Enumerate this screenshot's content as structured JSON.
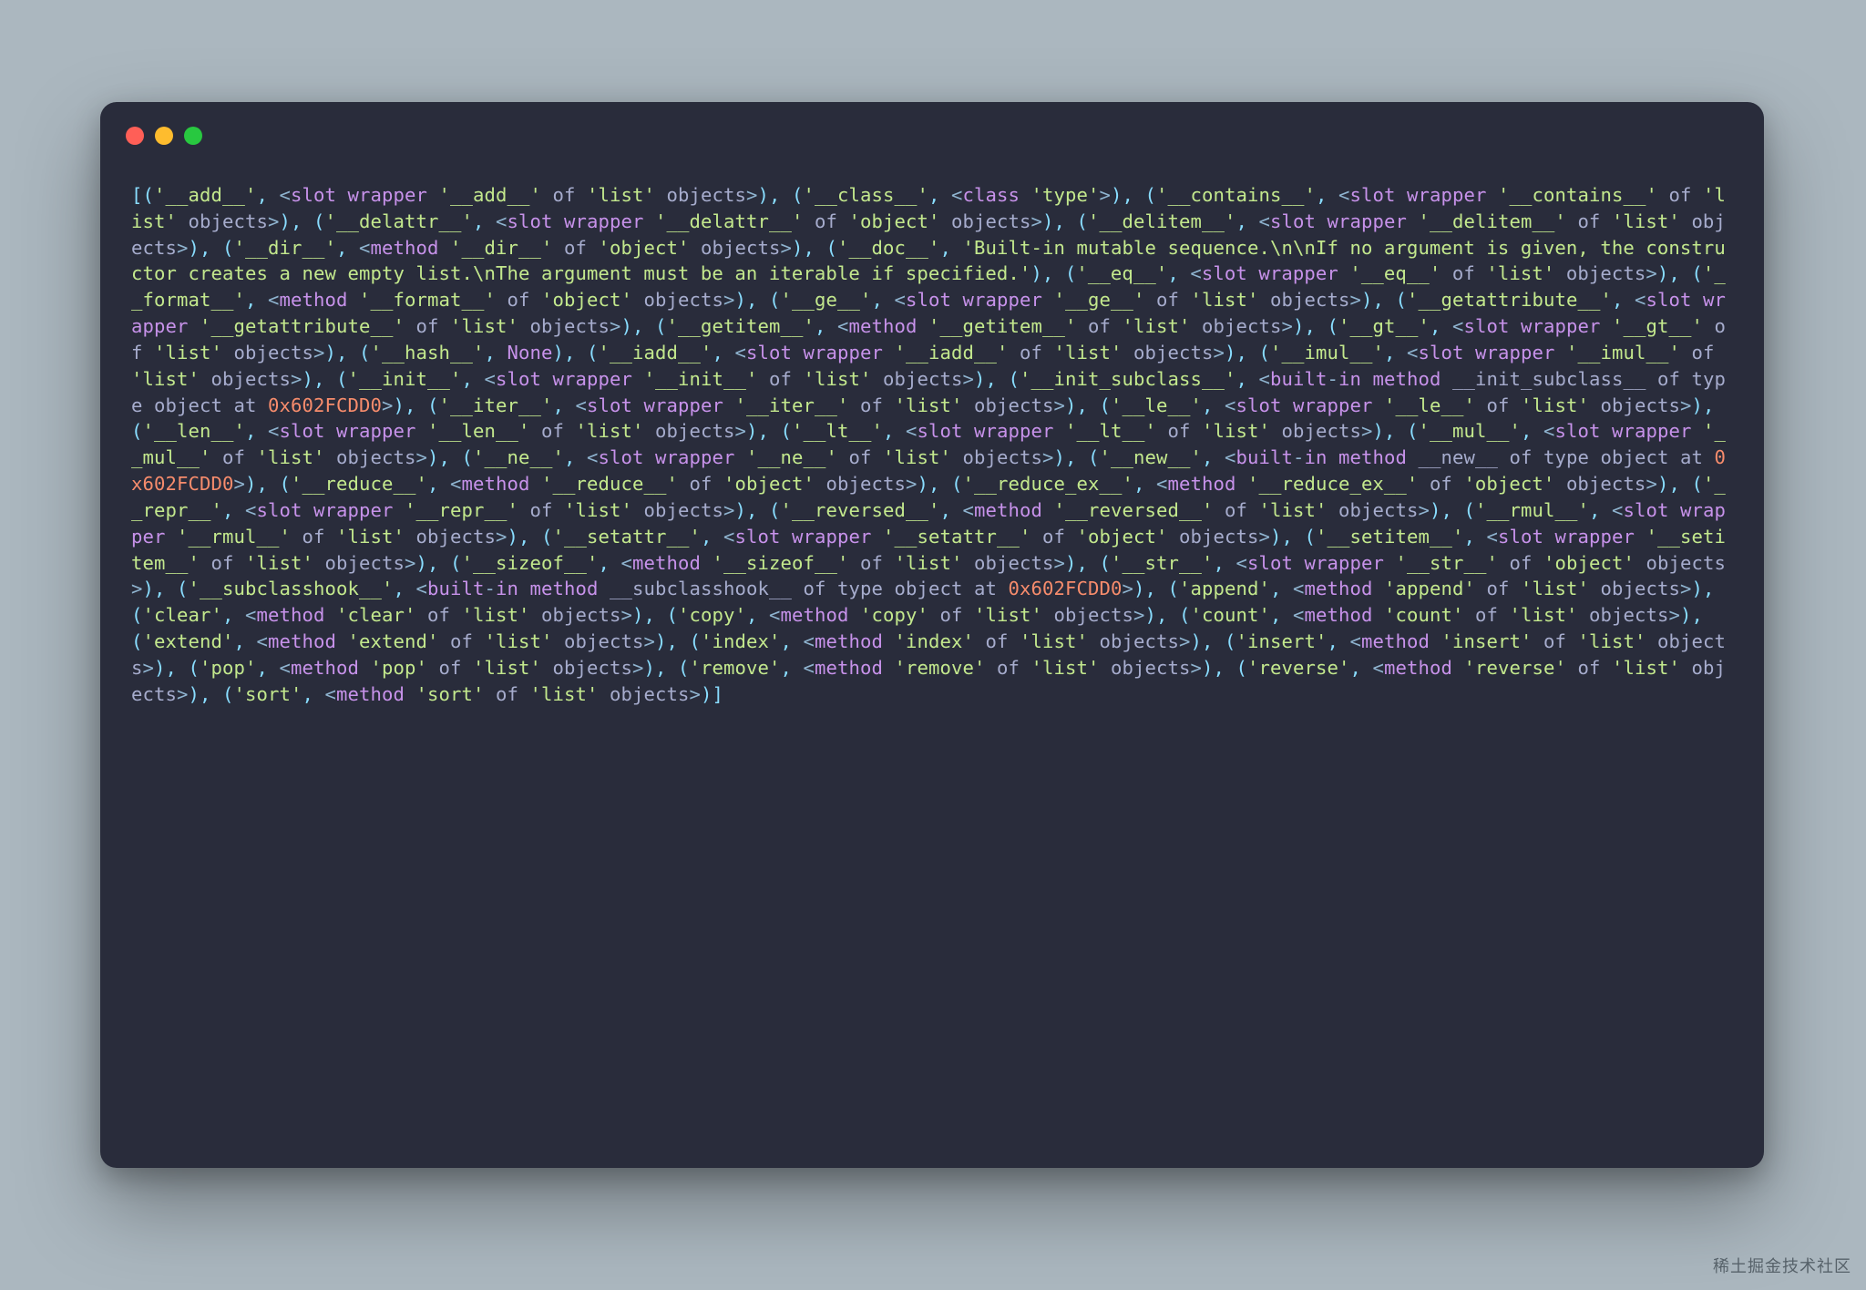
{
  "window": {
    "traffic_lights": [
      "red",
      "yellow",
      "green"
    ]
  },
  "watermark": "稀土掘金技术社区",
  "code": {
    "hex_addr": "0x602FCDD0",
    "doc_string": "Built-in mutable sequence.\\n\\nIf no argument is given, the constructor creates a new empty list.\\nThe argument must be an iterable if specified.",
    "entries": [
      {
        "key": "__add__",
        "type": "slot-wrapper",
        "of": "list"
      },
      {
        "key": "__class__",
        "type": "class",
        "cls": "type"
      },
      {
        "key": "__contains__",
        "type": "slot-wrapper",
        "of": "list"
      },
      {
        "key": "__delattr__",
        "type": "slot-wrapper",
        "of": "object"
      },
      {
        "key": "__delitem__",
        "type": "slot-wrapper",
        "of": "list"
      },
      {
        "key": "__dir__",
        "type": "method",
        "of": "object"
      },
      {
        "key": "__doc__",
        "type": "doc"
      },
      {
        "key": "__eq__",
        "type": "slot-wrapper",
        "of": "list"
      },
      {
        "key": "__format__",
        "type": "method",
        "of": "object"
      },
      {
        "key": "__ge__",
        "type": "slot-wrapper",
        "of": "list"
      },
      {
        "key": "__getattribute__",
        "type": "slot-wrapper",
        "of": "list"
      },
      {
        "key": "__getitem__",
        "type": "method",
        "of": "list"
      },
      {
        "key": "__gt__",
        "type": "slot-wrapper",
        "of": "list"
      },
      {
        "key": "__hash__",
        "type": "none"
      },
      {
        "key": "__iadd__",
        "type": "slot-wrapper",
        "of": "list"
      },
      {
        "key": "__imul__",
        "type": "slot-wrapper",
        "of": "list"
      },
      {
        "key": "__init__",
        "type": "slot-wrapper",
        "of": "list"
      },
      {
        "key": "__init_subclass__",
        "type": "builtin",
        "name": "__init_subclass__"
      },
      {
        "key": "__iter__",
        "type": "slot-wrapper",
        "of": "list"
      },
      {
        "key": "__le__",
        "type": "slot-wrapper",
        "of": "list"
      },
      {
        "key": "__len__",
        "type": "slot-wrapper",
        "of": "list"
      },
      {
        "key": "__lt__",
        "type": "slot-wrapper",
        "of": "list"
      },
      {
        "key": "__mul__",
        "type": "slot-wrapper",
        "of": "list"
      },
      {
        "key": "__ne__",
        "type": "slot-wrapper",
        "of": "list"
      },
      {
        "key": "__new__",
        "type": "builtin",
        "name": "__new__"
      },
      {
        "key": "__reduce__",
        "type": "method",
        "of": "object"
      },
      {
        "key": "__reduce_ex__",
        "type": "method",
        "of": "object"
      },
      {
        "key": "__repr__",
        "type": "slot-wrapper",
        "of": "list"
      },
      {
        "key": "__reversed__",
        "type": "method",
        "of": "list"
      },
      {
        "key": "__rmul__",
        "type": "slot-wrapper",
        "of": "list"
      },
      {
        "key": "__setattr__",
        "type": "slot-wrapper",
        "of": "object"
      },
      {
        "key": "__setitem__",
        "type": "slot-wrapper",
        "of": "list"
      },
      {
        "key": "__sizeof__",
        "type": "method",
        "of": "list"
      },
      {
        "key": "__str__",
        "type": "slot-wrapper",
        "of": "object"
      },
      {
        "key": "__subclasshook__",
        "type": "builtin",
        "name": "__subclasshook__"
      },
      {
        "key": "append",
        "type": "method",
        "of": "list"
      },
      {
        "key": "clear",
        "type": "method",
        "of": "list"
      },
      {
        "key": "copy",
        "type": "method",
        "of": "list"
      },
      {
        "key": "count",
        "type": "method",
        "of": "list"
      },
      {
        "key": "extend",
        "type": "method",
        "of": "list"
      },
      {
        "key": "index",
        "type": "method",
        "of": "list"
      },
      {
        "key": "insert",
        "type": "method",
        "of": "list"
      },
      {
        "key": "pop",
        "type": "method",
        "of": "list"
      },
      {
        "key": "remove",
        "type": "method",
        "of": "list"
      },
      {
        "key": "reverse",
        "type": "method",
        "of": "list"
      },
      {
        "key": "sort",
        "type": "method",
        "of": "list"
      }
    ]
  }
}
